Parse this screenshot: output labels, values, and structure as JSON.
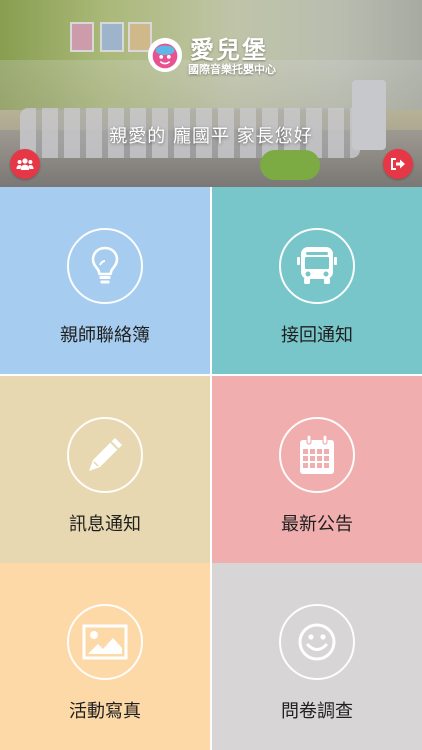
{
  "header": {
    "logo": {
      "name": "愛兒堡",
      "subtitle": "國際音樂托嬰中心"
    },
    "greeting": "親愛的 龐國平 家長您好",
    "left_button_icon": "group-icon",
    "right_button_icon": "logout-icon",
    "accent_color": "#e53745"
  },
  "tiles": [
    {
      "label": "親師聯絡簿",
      "icon": "lightbulb-icon",
      "color": "#a6cdef"
    },
    {
      "label": "接回通知",
      "icon": "bus-icon",
      "color": "#78c6c9"
    },
    {
      "label": "訊息通知",
      "icon": "pencil-icon",
      "color": "#e7d8b1"
    },
    {
      "label": "最新公告",
      "icon": "calendar-icon",
      "color": "#f0afae"
    },
    {
      "label": "活動寫真",
      "icon": "picture-icon",
      "color": "#fdd9a8"
    },
    {
      "label": "問卷調查",
      "icon": "smiley-icon",
      "color": "#d8d5d7"
    }
  ]
}
